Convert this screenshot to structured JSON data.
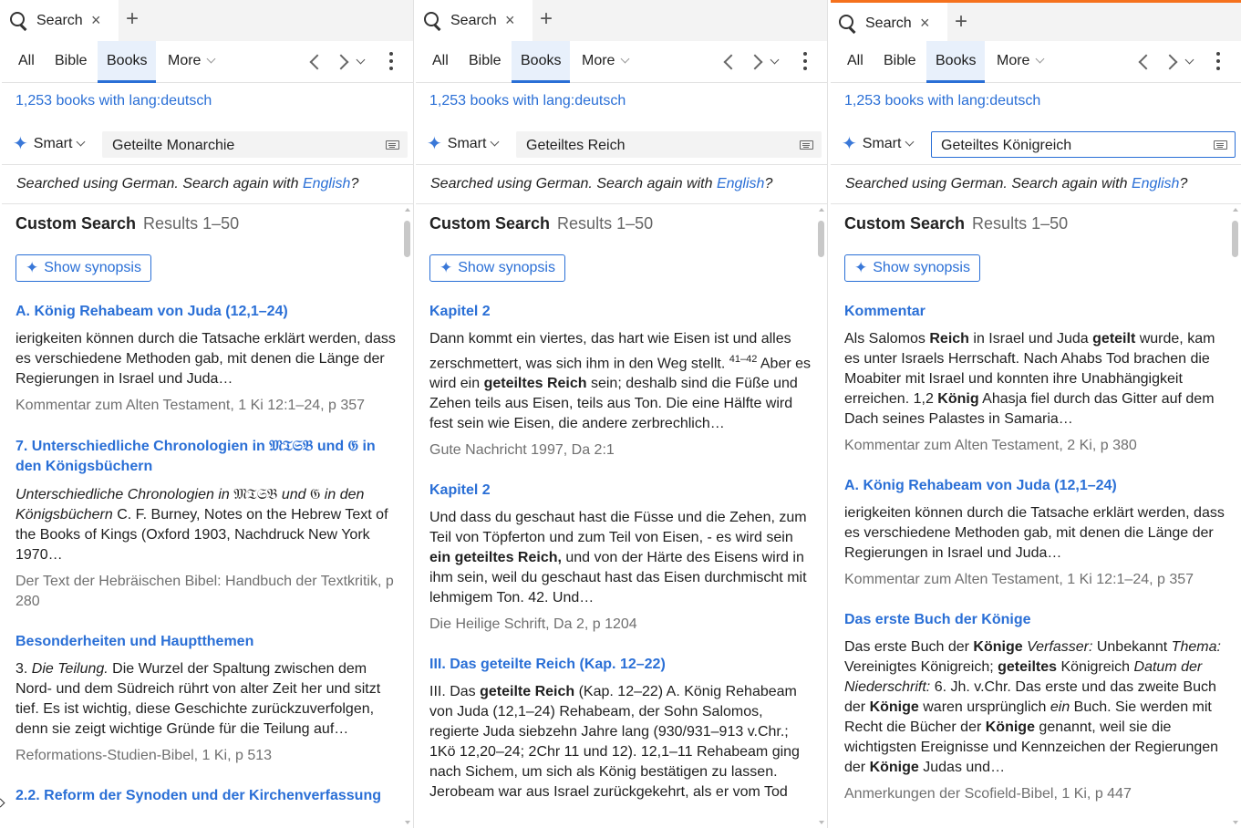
{
  "tab_bar": {
    "tab_label": "Search",
    "close_glyph": "×",
    "add_glyph": "+"
  },
  "nav": {
    "tabs": [
      "All",
      "Bible",
      "Books",
      "More"
    ],
    "selected": "Books"
  },
  "icons": {
    "search": "search-icon",
    "close": "close-icon",
    "add": "plus-icon",
    "back": "chevron-left-icon",
    "forward": "chevron-right-icon",
    "history": "chevron-down-icon",
    "menu": "kebab-menu-icon",
    "smart": "sparkle-icon",
    "keyboard": "keyboard-icon"
  },
  "colors": {
    "accent": "#2a6fd6",
    "active_tab_marker": "#f5711c",
    "muted": "#707070"
  },
  "common": {
    "summary": "1,253 books with lang:deutsch",
    "smart_label": "Smart",
    "lang_prefix": "Searched using German. Search again with ",
    "lang_link": "English",
    "lang_suffix": "?",
    "results_title": "Custom Search",
    "results_range": "Results 1–50",
    "synopsis_label": "Show synopsis"
  },
  "panels": [
    {
      "query": "Geteilte Monarchie",
      "hits": [
        {
          "title": "A. König Rehabeam von Juda (12,1–24)",
          "body": "ierigkeiten können durch die Tatsache erklärt werden, dass es verschiedene Methoden gab, mit denen die Länge der Regierungen in Israel und Juda…",
          "source": "Kommentar zum Alten Testament, 1 Ki 12:1–24, p 357"
        },
        {
          "title_pre": "7. Unterschiedliche Chronologien in ",
          "title_frak1": "𝔐𝔗𝔖𝔅",
          "title_mid": " und ",
          "title_frak2": "𝔊",
          "title_post": " in den Königsbüchern",
          "body_i1": "Unterschiedliche Chronologien in ",
          "body_f1": "𝔐𝔗𝔖𝔅",
          "body_i2": " und ",
          "body_f2": "𝔊",
          "body_i3": " in den Königsbüchern",
          "body_rest": " C. F. Burney, Notes on the Hebrew Text of the Books of Kings (Oxford 1903, Nachdruck New York 1970…",
          "source": "Der Text der Hebräischen Bibel: Handbuch der Textkritik, p 280"
        },
        {
          "title": "Besonderheiten und Hauptthemen",
          "body_pre": "3. ",
          "body_italic": "Die Teilung.",
          "body_rest": " Die Wurzel der Spaltung zwischen dem Nord- und dem Südreich rührt von alter Zeit her und sitzt tief. Es ist wichtig, diese Geschichte zurückzuverfolgen, denn sie zeigt wichtige Gründe für die Teilung auf…",
          "source": "Reformations-Studien-Bibel, 1 Ki, p 513"
        },
        {
          "title": "2.2. Reform der Synoden und der Kirchenverfassung"
        }
      ]
    },
    {
      "query": "Geteiltes Reich",
      "hits": [
        {
          "title": "Kapitel 2",
          "body_a": "Dann kommt ein viertes, das hart wie Eisen ist und alles zerschmettert, was sich ihm in den Weg stellt. ",
          "body_sup": "41–42",
          "body_b": " Aber es wird ein ",
          "body_bold": "geteiltes Reich",
          "body_c": " sein; deshalb sind die Füße und Zehen teils aus Eisen, teils aus Ton. Die eine Hälfte wird fest sein wie Eisen, die andere zerbrechlich…",
          "source": "Gute Nachricht 1997, Da 2:1"
        },
        {
          "title": "Kapitel 2",
          "body_a": "Und dass du geschaut hast die Füsse und die Zehen, zum Teil von Töpferton und zum Teil von Eisen, - es wird sein ",
          "body_bold": "ein geteiltes Reich,",
          "body_b": " und von der Härte des Eisens wird in ihm sein, weil du geschaut hast das Eisen durchmischt mit lehmigem Ton. 42.  Und…",
          "source": "Die Heilige Schrift, Da 2, p 1204"
        },
        {
          "title": "III. Das geteilte Reich (Kap. 12–22)",
          "body_a": "III. Das ",
          "body_bold": "geteilte Reich",
          "body_b": " (Kap. 12–22) A. König Rehabeam von Juda (12,1–24) Rehabeam, der Sohn Salomos, regierte Juda siebzehn Jahre lang (930/931–913 v.Chr.; 1Kö 12,20–24; 2Chr 11 und 12). 12,1–11 Rehabeam ging nach Sichem, um sich als König bestätigen zu lassen. Jerobeam war aus Israel zurückgekehrt, als er vom Tod"
        }
      ]
    },
    {
      "query": "Geteiltes Königreich",
      "hits": [
        {
          "title": "Kommentar",
          "b1": "Als Salomos ",
          "s1": "Reich",
          "b2": " in Israel und Juda ",
          "s2": "geteilt",
          "b3": " wurde, kam es unter Israels Herrschaft. Nach Ahabs Tod brachen die Moabiter mit Israel und konnten ihre Unabhängigkeit erreichen. 1,2 ",
          "s3": "König",
          "b4": " Ahasja fiel durch das Gitter auf dem Dach seines Palastes in Samaria…",
          "source": "Kommentar zum Alten Testament, 2 Ki, p 380"
        },
        {
          "title": "A. König Rehabeam von Juda (12,1–24)",
          "body": "ierigkeiten können durch die Tatsache erklärt werden, dass es verschiedene Methoden gab, mit denen die Länge der Regierungen in Israel und Juda…",
          "source": "Kommentar zum Alten Testament, 1 Ki 12:1–24, p 357"
        },
        {
          "title": "Das erste Buch der Könige",
          "b1": "Das erste Buch der ",
          "s1": "Könige",
          "i1": " Verfasser:",
          "b2": " Unbekannt ",
          "i2": "Thema:",
          "b3": " Vereinigtes Königreich; ",
          "s2": "geteiltes",
          "b4": " Königreich ",
          "i3": "Datum der Niederschrift:",
          "b5": " 6. Jh. v.Chr. Das erste und das zweite Buch der ",
          "s3": "Könige",
          "b6": " waren ursprünglich ",
          "i4": "ein",
          "b7": " Buch. Sie werden mit Recht die Bücher der ",
          "s4": "Könige",
          "b8": " genannt, weil sie die wichtigsten Ereignisse und Kennzeichen der Regierungen der ",
          "s5": "Könige",
          "b9": " Judas und…",
          "source": "Anmerkungen der Scofield-Bibel, 1 Ki, p 447"
        }
      ]
    }
  ]
}
